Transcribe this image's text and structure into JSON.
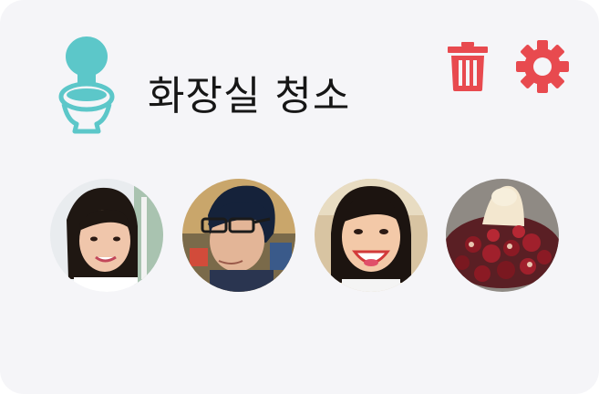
{
  "task": {
    "title": "화장실 청소",
    "icon": "toilet-icon",
    "icon_color": "#5cc7c9"
  },
  "actions": {
    "delete_icon": "trash-icon",
    "settings_icon": "gear-icon",
    "accent_color": "#e84a4f"
  },
  "members": [
    {
      "icon": "woman-portrait-photo"
    },
    {
      "icon": "man-with-glasses-photo"
    },
    {
      "icon": "smiling-woman-photo"
    },
    {
      "icon": "cherry-dessert-photo"
    }
  ],
  "colors": {
    "card_background": "#f5f5f8",
    "title_text": "#161616"
  }
}
